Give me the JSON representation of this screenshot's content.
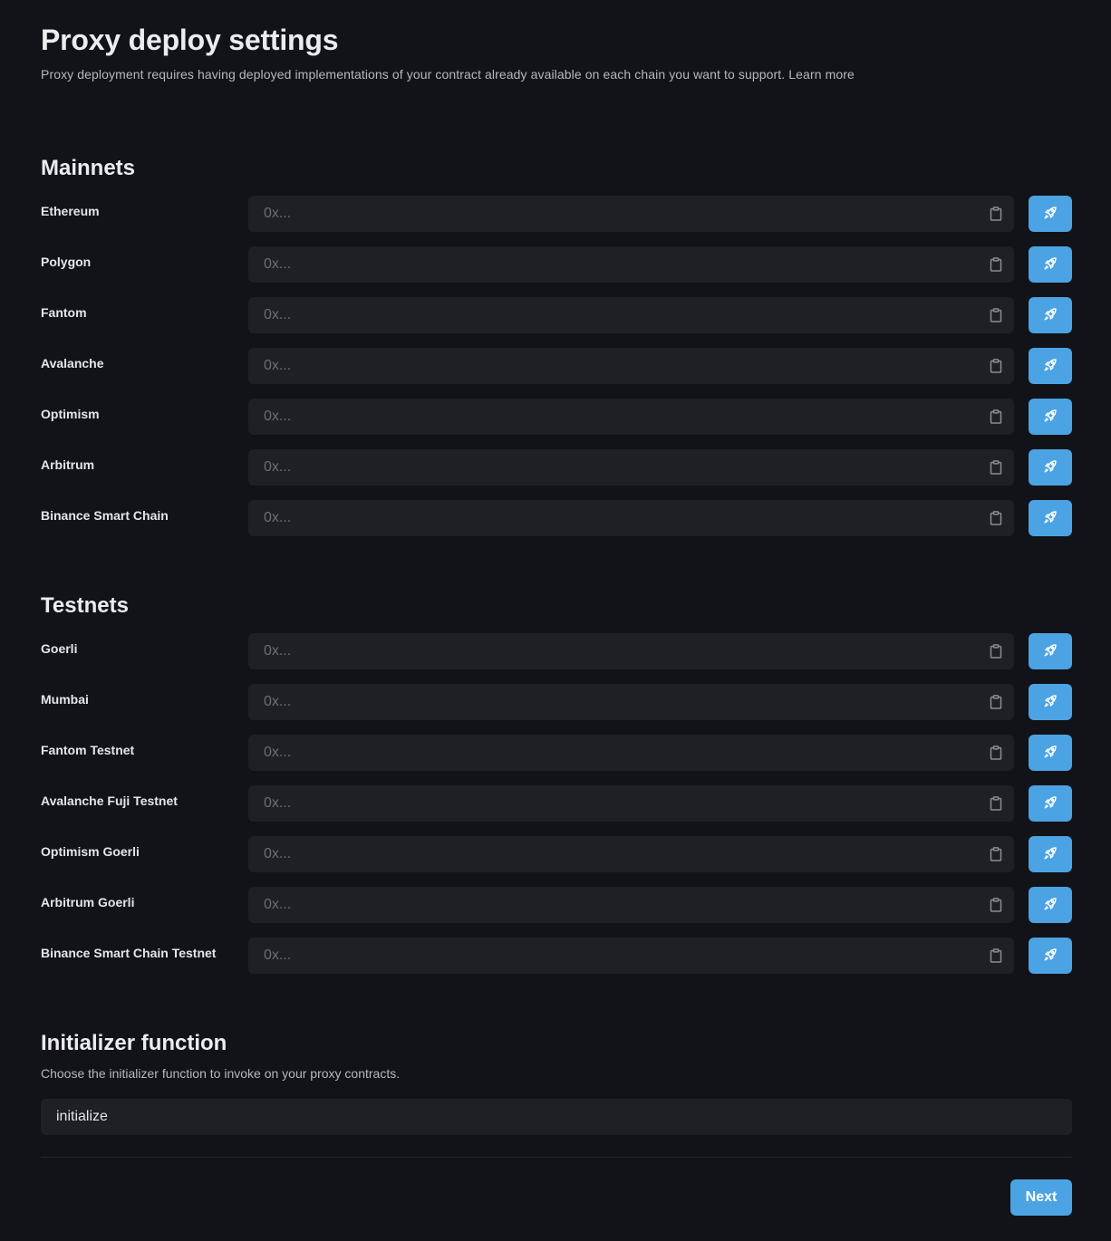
{
  "header": {
    "title": "Proxy deploy settings",
    "description": "Proxy deployment requires having deployed implementations of your contract already available on each chain you want to support.",
    "learn_more": "Learn more"
  },
  "address_placeholder": "0x...",
  "colors": {
    "background": "#111318",
    "input_background": "#1e2025",
    "accent": "#4ba3e3"
  },
  "icons": {
    "paste": "clipboard-icon",
    "deploy": "rocket-icon"
  },
  "mainnets": {
    "title": "Mainnets",
    "chains": [
      {
        "label": "Ethereum",
        "value": ""
      },
      {
        "label": "Polygon",
        "value": ""
      },
      {
        "label": "Fantom",
        "value": ""
      },
      {
        "label": "Avalanche",
        "value": ""
      },
      {
        "label": "Optimism",
        "value": ""
      },
      {
        "label": "Arbitrum",
        "value": ""
      },
      {
        "label": "Binance Smart Chain",
        "value": ""
      }
    ]
  },
  "testnets": {
    "title": "Testnets",
    "chains": [
      {
        "label": "Goerli",
        "value": ""
      },
      {
        "label": "Mumbai",
        "value": ""
      },
      {
        "label": "Fantom Testnet",
        "value": ""
      },
      {
        "label": "Avalanche Fuji Testnet",
        "value": ""
      },
      {
        "label": "Optimism Goerli",
        "value": ""
      },
      {
        "label": "Arbitrum Goerli",
        "value": ""
      },
      {
        "label": "Binance Smart Chain Testnet",
        "value": ""
      }
    ]
  },
  "initializer": {
    "title": "Initializer function",
    "description": "Choose the initializer function to invoke on your proxy contracts.",
    "value": "initialize"
  },
  "footer": {
    "next_label": "Next"
  }
}
